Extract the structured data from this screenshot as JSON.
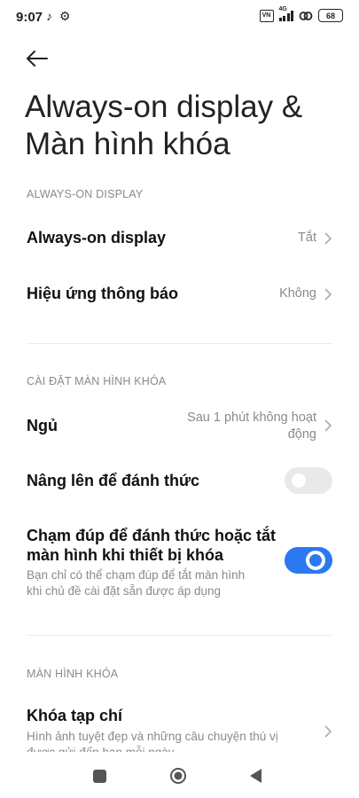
{
  "status_bar": {
    "time": "9:07",
    "network": "4G",
    "battery": "68",
    "sim_label": "VN"
  },
  "page": {
    "title": "Always-on display & Màn hình khóa"
  },
  "sections": {
    "aod_header": "ALWAYS-ON DISPLAY",
    "lock_settings_header": "CÀI ĐẶT MÀN HÌNH KHÓA",
    "lock_screen_header": "MÀN HÌNH KHÓA"
  },
  "rows": {
    "aod": {
      "label": "Always-on display",
      "value": "Tắt"
    },
    "notification_effect": {
      "label": "Hiệu ứng thông báo",
      "value": "Không"
    },
    "sleep": {
      "label": "Ngủ",
      "value_line1": "Sau 1 phút không hoạt",
      "value_line2": "động"
    },
    "raise_to_wake": {
      "label": "Nâng lên để đánh thức",
      "toggle": false
    },
    "double_tap": {
      "label_line1": "Chạm đúp để đánh thức hoặc tắt",
      "label_line2": "màn hình khi thiết bị khóa",
      "desc_line1": "Bạn chỉ có thể chạm đúp để tắt màn hình",
      "desc_line2": "khi chủ đề cài đặt sẵn được áp dụng",
      "toggle": true
    },
    "magazine_lock": {
      "label": "Khóa tạp chí",
      "desc_line1": "Hình ảnh tuyệt đẹp và những câu chuyện thú vị",
      "desc_line2": "được gửi đến bạn mỗi ngày"
    }
  },
  "colors": {
    "accent": "#2a79f1",
    "toggle_off": "#e9e9e9",
    "secondary_text": "#8a8a8a"
  }
}
